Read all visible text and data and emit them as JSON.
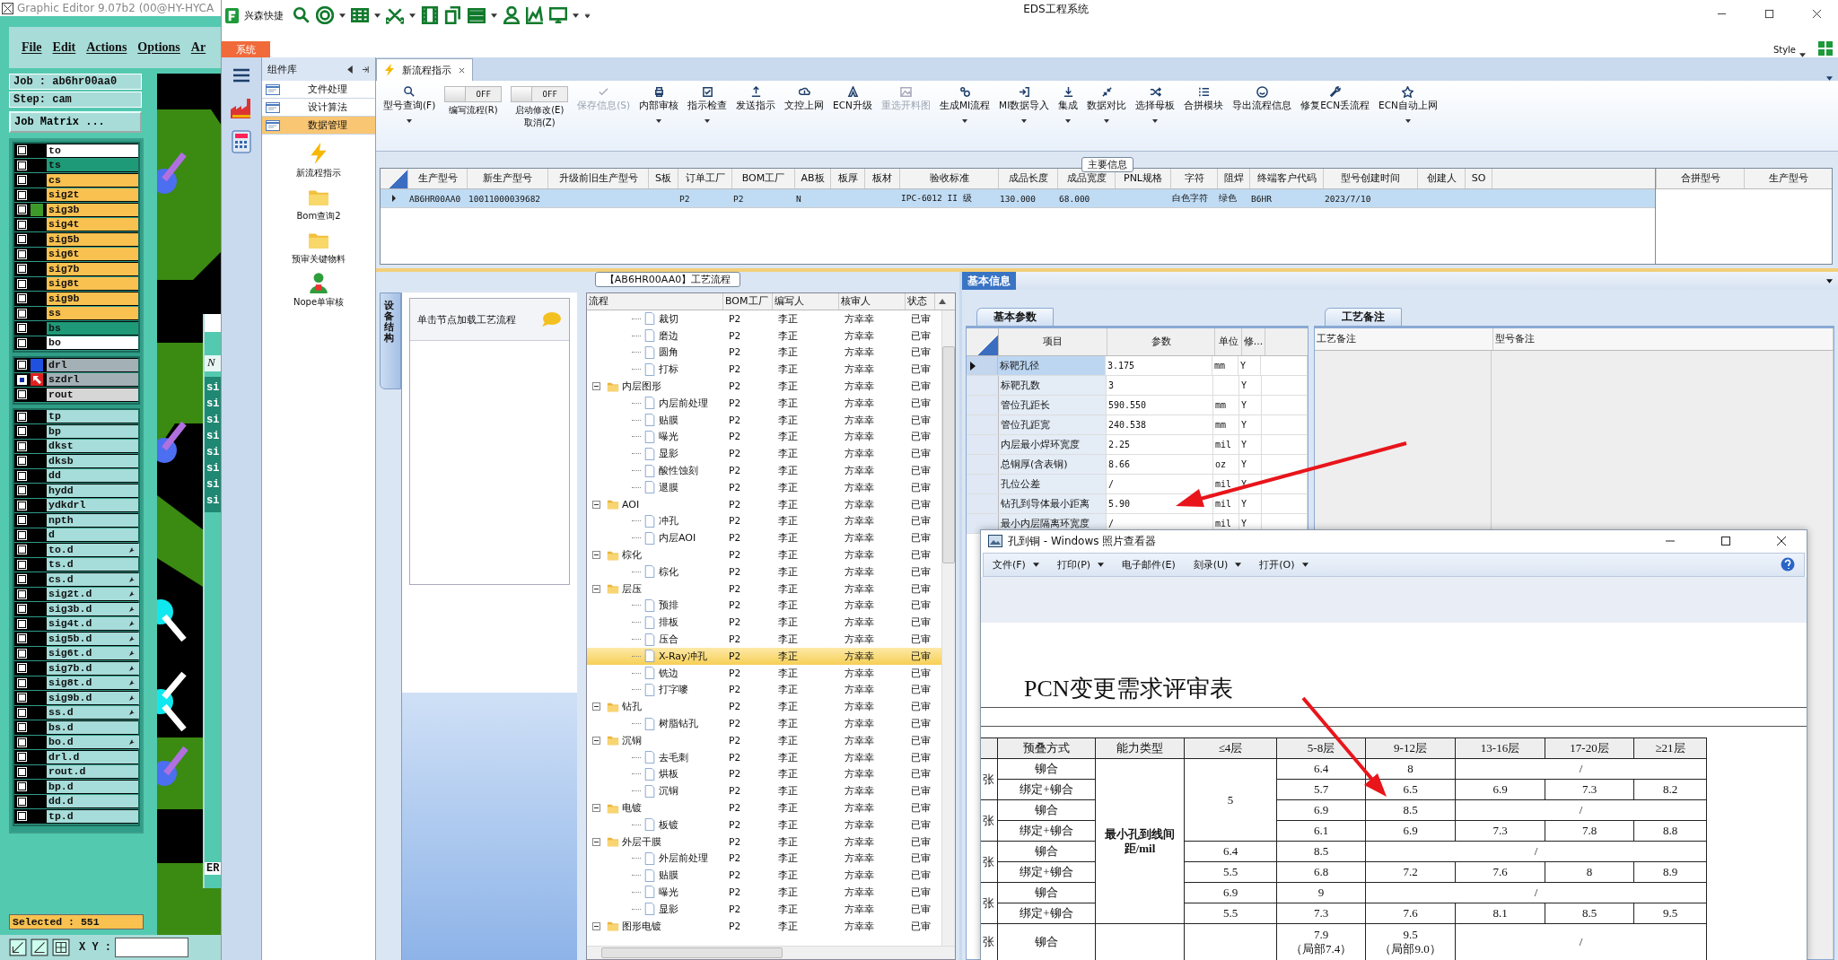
{
  "editor": {
    "title": "Graphic Editor 9.07b2 (00@HY-HYCA",
    "menu": [
      "File",
      "Edit",
      "Actions",
      "Options",
      "Ar"
    ],
    "job": "Job : ab6hr00aa0",
    "step": "Step: cam",
    "matrix_button": "Job Matrix ...",
    "board_layers": [
      {
        "name": "to",
        "color": "#ffffff",
        "checked": false
      },
      {
        "name": "ts",
        "color": "#1f9a78",
        "checked": false
      },
      {
        "name": "cs",
        "color": "#f8c150",
        "checked": false
      },
      {
        "name": "sig2t",
        "color": "#f8c150",
        "checked": false
      },
      {
        "name": "sig3b",
        "color": "#f8c150",
        "swatch": {
          "color": "#3d9a2a"
        },
        "checked": false
      },
      {
        "name": "sig4t",
        "color": "#f8c150",
        "checked": false
      },
      {
        "name": "sig5b",
        "color": "#f8c150",
        "checked": false
      },
      {
        "name": "sig6t",
        "color": "#f8c150",
        "checked": false
      },
      {
        "name": "sig7b",
        "color": "#f8c150",
        "checked": false
      },
      {
        "name": "sig8t",
        "color": "#f8c150",
        "checked": false
      },
      {
        "name": "sig9b",
        "color": "#f8c150",
        "checked": false
      },
      {
        "name": "ss",
        "color": "#f8c150",
        "checked": false
      },
      {
        "name": "bs",
        "color": "#1f9a78",
        "checked": false
      },
      {
        "name": "bo",
        "color": "#ffffff",
        "checked": false
      }
    ],
    "drill_layers": [
      {
        "name": "drl",
        "color": "#a3b0b6",
        "swatch": {
          "color": "#2050e0"
        },
        "selected": false
      },
      {
        "name": "szdrl",
        "color": "#a3b0b6",
        "selected": true
      },
      {
        "name": "rout",
        "color": "#d6d6d6",
        "selected": false
      }
    ],
    "misc_layers": [
      {
        "name": "tp",
        "color": "#a6dcd9",
        "flag": false,
        "checked": false
      },
      {
        "name": "bp",
        "color": "#a6dcd9",
        "flag": false,
        "checked": false
      },
      {
        "name": "dkst",
        "color": "#a6dcd9",
        "flag": false,
        "checked": false
      },
      {
        "name": "dksb",
        "color": "#a6dcd9",
        "flag": false,
        "checked": false
      },
      {
        "name": "dd",
        "color": "#a6dcd9",
        "flag": false,
        "checked": false
      },
      {
        "name": "hydd",
        "color": "#a6dcd9",
        "flag": false,
        "checked": false
      },
      {
        "name": "ydkdrl",
        "color": "#a6dcd9",
        "flag": false,
        "checked": false
      },
      {
        "name": "npth",
        "color": "#a6dcd9",
        "flag": false,
        "checked": false
      },
      {
        "name": "d",
        "color": "#a6dcd9",
        "flag": false,
        "checked": false
      },
      {
        "name": "to.d",
        "color": "#a6dcd9",
        "flag": true,
        "checked": false
      },
      {
        "name": "ts.d",
        "color": "#a6dcd9",
        "flag": false,
        "checked": false
      },
      {
        "name": "cs.d",
        "color": "#a6dcd9",
        "flag": true,
        "checked": false
      },
      {
        "name": "sig2t.d",
        "color": "#a6dcd9",
        "flag": true,
        "checked": false
      },
      {
        "name": "sig3b.d",
        "color": "#a6dcd9",
        "flag": true,
        "checked": false
      },
      {
        "name": "sig4t.d",
        "color": "#a6dcd9",
        "flag": true,
        "checked": false
      },
      {
        "name": "sig5b.d",
        "color": "#a6dcd9",
        "flag": true,
        "checked": false
      },
      {
        "name": "sig6t.d",
        "color": "#a6dcd9",
        "flag": true,
        "checked": false
      },
      {
        "name": "sig7b.d",
        "color": "#a6dcd9",
        "flag": true,
        "checked": false
      },
      {
        "name": "sig8t.d",
        "color": "#a6dcd9",
        "flag": true,
        "checked": false
      },
      {
        "name": "sig9b.d",
        "color": "#a6dcd9",
        "flag": true,
        "checked": false
      },
      {
        "name": "ss.d",
        "color": "#a6dcd9",
        "flag": true,
        "checked": false
      },
      {
        "name": "bs.d",
        "color": "#a6dcd9",
        "flag": false,
        "checked": false
      },
      {
        "name": "bo.d",
        "color": "#a6dcd9",
        "flag": true,
        "checked": false
      },
      {
        "name": "drl.d",
        "color": "#a6dcd9",
        "flag": false,
        "checked": false
      },
      {
        "name": "rout.d",
        "color": "#a6dcd9",
        "flag": false,
        "checked": false
      },
      {
        "name": "bp.d",
        "color": "#a6dcd9",
        "flag": false,
        "checked": false
      },
      {
        "name": "dd.d",
        "color": "#a6dcd9",
        "flag": false,
        "checked": false
      },
      {
        "name": "tp.d",
        "color": "#a6dcd9",
        "flag": false,
        "checked": false
      }
    ],
    "dialog": {
      "field": "N",
      "items": [
        "si",
        "si",
        "si",
        "si",
        "si",
        "si",
        "si",
        "si"
      ],
      "label": "ER"
    },
    "selected": "Selected : 551",
    "xy_label": "X Y :"
  },
  "app": {
    "name": "兴森快捷",
    "title": "EDS工程系统",
    "system_tab": "系统",
    "style_label": "Style"
  },
  "components": {
    "title": "组件库",
    "categories": [
      {
        "label": "文件处理",
        "selected": false
      },
      {
        "label": "设计算法",
        "selected": false
      },
      {
        "label": "数据管理",
        "selected": true
      }
    ],
    "tools": [
      {
        "label": "新流程指示"
      },
      {
        "label": "Bom查询2"
      },
      {
        "label": "预审关键物料"
      },
      {
        "label": "Nope单审核"
      }
    ]
  },
  "tab": {
    "label": "新流程指示",
    "selected": true
  },
  "toolbar": [
    {
      "kind": "button",
      "label": "型号查询(F)",
      "dropdown": true,
      "disabled": false
    },
    {
      "kind": "toggle",
      "text": "OFF",
      "on": false,
      "label": "编写流程(R)"
    },
    {
      "kind": "toggle",
      "text": "OFF",
      "on": false,
      "label": "启动修改(E)",
      "label2": "取消(Z)"
    },
    {
      "kind": "button",
      "label": "保存信息(S)",
      "dropdown": false,
      "disabled": true
    },
    {
      "kind": "button",
      "label": "内部审核",
      "dropdown": true,
      "disabled": false
    },
    {
      "kind": "button",
      "label": "指示检查",
      "dropdown": true,
      "disabled": false
    },
    {
      "kind": "button",
      "label": "发送指示",
      "dropdown": false,
      "disabled": false
    },
    {
      "kind": "button",
      "label": "文控上网",
      "dropdown": false,
      "disabled": false
    },
    {
      "kind": "button",
      "label": "ECN升级",
      "dropdown": false,
      "disabled": false
    },
    {
      "kind": "button",
      "label": "重选开料图",
      "dropdown": false,
      "disabled": true
    },
    {
      "kind": "button",
      "label": "生成MI流程",
      "dropdown": true,
      "disabled": false
    },
    {
      "kind": "button",
      "label": "MI数据导入",
      "dropdown": true,
      "disabled": false
    },
    {
      "kind": "button",
      "label": "集成",
      "dropdown": true,
      "disabled": false
    },
    {
      "kind": "button",
      "label": "数据对比",
      "dropdown": true,
      "disabled": false
    },
    {
      "kind": "button",
      "label": "选择母板",
      "dropdown": true,
      "disabled": false
    },
    {
      "kind": "button",
      "label": "合拼模块",
      "dropdown": false,
      "disabled": false
    },
    {
      "kind": "button",
      "label": "导出流程信息",
      "dropdown": false,
      "disabled": false
    },
    {
      "kind": "button",
      "label": "修复ECN丢流程",
      "dropdown": false,
      "disabled": false
    },
    {
      "kind": "button",
      "label": "ECN自动上网",
      "dropdown": true,
      "disabled": false
    }
  ],
  "main_info": {
    "legend": "主要信息",
    "columns": [
      "生产型号",
      "新生产型号",
      "升级前旧生产型号",
      "S板",
      "订单工厂",
      "BOM工厂",
      "AB板",
      "板厚",
      "板材",
      "验收标准",
      "成品长度",
      "成品宽度",
      "PNL规格",
      "字符",
      "阻焊",
      "终端客户代码",
      "型号创建时间",
      "创建人",
      "SO"
    ],
    "rows": [
      {
        "selected": true,
        "cells": [
          {
            "text": "AB6HR00AA0"
          },
          {
            "text": "10011000039682"
          },
          {},
          {},
          {
            "text": "P2"
          },
          {
            "text": "P2"
          },
          {
            "text": "N"
          },
          {},
          {},
          {
            "text": "IPC-6012 II 级"
          },
          {
            "text": "130.000"
          },
          {
            "text": "68.000"
          },
          {},
          {
            "text": "白色字符"
          },
          {
            "text": "绿色"
          },
          {
            "text": "B6HR"
          },
          {
            "text": "2023/7/10"
          },
          {},
          {}
        ]
      }
    ],
    "side_columns": [
      "合拼型号",
      "生产型号"
    ]
  },
  "flow": {
    "title": "【AB6HR00AA0】工艺流程",
    "side_tab": "设备结构",
    "hint": "单击节点加载工艺流程",
    "columns": [
      "流程",
      "BOM工厂",
      "编写人",
      "核审人",
      "状态"
    ],
    "tree": [
      {
        "kind": "leaf",
        "label": "裁切",
        "bom": "P2",
        "writer": "李正",
        "reviewer": "方幸幸",
        "status": "已审",
        "selected": false
      },
      {
        "kind": "leaf",
        "label": "磨边",
        "bom": "P2",
        "writer": "李正",
        "reviewer": "方幸幸",
        "status": "已审",
        "selected": false
      },
      {
        "kind": "leaf",
        "label": "圆角",
        "bom": "P2",
        "writer": "李正",
        "reviewer": "方幸幸",
        "status": "已审",
        "selected": false
      },
      {
        "kind": "leaf",
        "label": "打标",
        "bom": "P2",
        "writer": "李正",
        "reviewer": "方幸幸",
        "status": "已审",
        "selected": false
      },
      {
        "kind": "folder",
        "label": "内层图形",
        "bom": "P2",
        "writer": "李正",
        "reviewer": "方幸幸",
        "status": "已审",
        "selected": false,
        "expanded": true,
        "children": [
          {
            "kind": "leaf",
            "label": "内层前处理",
            "bom": "P2",
            "writer": "李正",
            "reviewer": "方幸幸",
            "status": "已审",
            "selected": false
          },
          {
            "kind": "leaf",
            "label": "贴膜",
            "bom": "P2",
            "writer": "李正",
            "reviewer": "方幸幸",
            "status": "已审",
            "selected": false
          },
          {
            "kind": "leaf",
            "label": "曝光",
            "bom": "P2",
            "writer": "李正",
            "reviewer": "方幸幸",
            "status": "已审",
            "selected": false
          },
          {
            "kind": "leaf",
            "label": "显影",
            "bom": "P2",
            "writer": "李正",
            "reviewer": "方幸幸",
            "status": "已审",
            "selected": false
          },
          {
            "kind": "leaf",
            "label": "酸性蚀刻",
            "bom": "P2",
            "writer": "李正",
            "reviewer": "方幸幸",
            "status": "已审",
            "selected": false
          },
          {
            "kind": "leaf",
            "label": "退膜",
            "bom": "P2",
            "writer": "李正",
            "reviewer": "方幸幸",
            "status": "已审",
            "selected": false
          }
        ]
      },
      {
        "kind": "folder",
        "label": "AOI",
        "bom": "P2",
        "writer": "李正",
        "reviewer": "方幸幸",
        "status": "已审",
        "selected": false,
        "expanded": true,
        "children": [
          {
            "kind": "leaf",
            "label": "冲孔",
            "bom": "P2",
            "writer": "李正",
            "reviewer": "方幸幸",
            "status": "已审",
            "selected": false
          },
          {
            "kind": "leaf",
            "label": "内层AOI",
            "bom": "P2",
            "writer": "李正",
            "reviewer": "方幸幸",
            "status": "已审",
            "selected": false
          }
        ]
      },
      {
        "kind": "folder",
        "label": "棕化",
        "bom": "P2",
        "writer": "李正",
        "reviewer": "方幸幸",
        "status": "已审",
        "selected": false,
        "expanded": true,
        "children": [
          {
            "kind": "leaf",
            "label": "棕化",
            "bom": "P2",
            "writer": "李正",
            "reviewer": "方幸幸",
            "status": "已审",
            "selected": false
          }
        ]
      },
      {
        "kind": "folder",
        "label": "层压",
        "bom": "P2",
        "writer": "李正",
        "reviewer": "方幸幸",
        "status": "已审",
        "selected": false,
        "expanded": true,
        "children": [
          {
            "kind": "leaf",
            "label": "预排",
            "bom": "P2",
            "writer": "李正",
            "reviewer": "方幸幸",
            "status": "已审",
            "selected": false
          },
          {
            "kind": "leaf",
            "label": "排板",
            "bom": "P2",
            "writer": "李正",
            "reviewer": "方幸幸",
            "status": "已审",
            "selected": false
          },
          {
            "kind": "leaf",
            "label": "压合",
            "bom": "P2",
            "writer": "李正",
            "reviewer": "方幸幸",
            "status": "已审",
            "selected": false
          },
          {
            "kind": "leaf",
            "label": "X-Ray冲孔",
            "bom": "P2",
            "writer": "李正",
            "reviewer": "方幸幸",
            "status": "已审",
            "selected": true
          },
          {
            "kind": "leaf",
            "label": "铣边",
            "bom": "P2",
            "writer": "李正",
            "reviewer": "方幸幸",
            "status": "已审",
            "selected": false
          },
          {
            "kind": "leaf",
            "label": "打字嘜",
            "bom": "P2",
            "writer": "李正",
            "reviewer": "方幸幸",
            "status": "已审",
            "selected": false
          }
        ]
      },
      {
        "kind": "folder",
        "label": "钻孔",
        "bom": "P2",
        "writer": "李正",
        "reviewer": "方幸幸",
        "status": "已审",
        "selected": false,
        "expanded": true,
        "children": [
          {
            "kind": "leaf",
            "label": "树脂钻孔",
            "bom": "P2",
            "writer": "李正",
            "reviewer": "方幸幸",
            "status": "已审",
            "selected": false
          }
        ]
      },
      {
        "kind": "folder",
        "label": "沉铜",
        "bom": "P2",
        "writer": "李正",
        "reviewer": "方幸幸",
        "status": "已审",
        "selected": false,
        "expanded": true,
        "children": [
          {
            "kind": "leaf",
            "label": "去毛刺",
            "bom": "P2",
            "writer": "李正",
            "reviewer": "方幸幸",
            "status": "已审",
            "selected": false
          },
          {
            "kind": "leaf",
            "label": "烘板",
            "bom": "P2",
            "writer": "李正",
            "reviewer": "方幸幸",
            "status": "已审",
            "selected": false
          },
          {
            "kind": "leaf",
            "label": "沉铜",
            "bom": "P2",
            "writer": "李正",
            "reviewer": "方幸幸",
            "status": "已审",
            "selected": false
          }
        ]
      },
      {
        "kind": "folder",
        "label": "电镀",
        "bom": "P2",
        "writer": "李正",
        "reviewer": "方幸幸",
        "status": "已审",
        "selected": false,
        "expanded": true,
        "children": [
          {
            "kind": "leaf",
            "label": "板镀",
            "bom": "P2",
            "writer": "李正",
            "reviewer": "方幸幸",
            "status": "已审",
            "selected": false
          }
        ]
      },
      {
        "kind": "folder",
        "label": "外层干膜",
        "bom": "P2",
        "writer": "李正",
        "reviewer": "方幸幸",
        "status": "已审",
        "selected": false,
        "expanded": true,
        "children": [
          {
            "kind": "leaf",
            "label": "外层前处理",
            "bom": "P2",
            "writer": "李正",
            "reviewer": "方幸幸",
            "status": "已审",
            "selected": false
          },
          {
            "kind": "leaf",
            "label": "贴膜",
            "bom": "P2",
            "writer": "李正",
            "reviewer": "方幸幸",
            "status": "已审",
            "selected": false
          },
          {
            "kind": "leaf",
            "label": "曝光",
            "bom": "P2",
            "writer": "李正",
            "reviewer": "方幸幸",
            "status": "已审",
            "selected": false
          },
          {
            "kind": "leaf",
            "label": "显影",
            "bom": "P2",
            "writer": "李正",
            "reviewer": "方幸幸",
            "status": "已审",
            "selected": false
          }
        ]
      },
      {
        "kind": "folder",
        "label": "图形电镀",
        "bom": "P2",
        "writer": "李正",
        "reviewer": "方幸幸",
        "status": "已审",
        "selected": false,
        "expanded": true
      }
    ]
  },
  "basic_info": {
    "tab": "基本信息",
    "params_tab": "基本参数",
    "notes_tab": "工艺备注",
    "columns": [
      "项目",
      "参数",
      "单位",
      "修..."
    ],
    "params": [
      {
        "item": "标靶孔径",
        "value": "3.175",
        "unit": "mm",
        "mod": "Y",
        "selected": true
      },
      {
        "item": "标靶孔数",
        "value": "3",
        "mod": "Y",
        "selected": false
      },
      {
        "item": "管位孔距长",
        "value": "590.550",
        "unit": "mm",
        "mod": "Y",
        "selected": false
      },
      {
        "item": "管位孔距宽",
        "value": "240.538",
        "unit": "mm",
        "mod": "Y",
        "selected": false
      },
      {
        "item": "内层最小焊环宽度",
        "value": "2.25",
        "unit": "mil",
        "mod": "Y",
        "selected": false
      },
      {
        "item": "总铜厚(含表铜)",
        "value": "8.66",
        "unit": "oz",
        "mod": "Y",
        "selected": false
      },
      {
        "item": "孔位公差",
        "value": "/",
        "unit": "mil",
        "mod": "Y",
        "selected": false
      },
      {
        "item": "钻孔到导体最小距离",
        "value": "5.90",
        "unit": "mil",
        "mod": "Y",
        "selected": false
      },
      {
        "item": "最小内层隔离环宽度",
        "value": "/",
        "unit": "mil",
        "mod": "Y",
        "selected": false
      }
    ],
    "notes_columns": [
      "工艺备注",
      "型号备注"
    ]
  },
  "viewer": {
    "title": "孔到铜 - Windows 照片查看器",
    "menu": [
      {
        "label": "文件(F)",
        "dropdown": true
      },
      {
        "label": "打印(P)",
        "dropdown": true
      },
      {
        "label": "电子邮件(E)",
        "dropdown": false
      },
      {
        "label": "刻录(U)",
        "dropdown": true
      },
      {
        "label": "打开(O)",
        "dropdown": true
      }
    ],
    "doc_title": "PCN变更需求评审表",
    "header": [
      "预叠方式",
      "能力类型",
      "≤4层",
      "5-8层",
      "9-12层",
      "13-16层",
      "17-20层",
      "≥21层"
    ],
    "rows": [
      [
        {
          "text": "张",
          "rowspan": 2
        },
        {
          "text": "铆合"
        },
        {
          "text": "最小孔到线间距/mil",
          "rowspan": 8,
          "kind": "caption"
        },
        {
          "text": "5",
          "rowspan": 4
        },
        {
          "text": "6.4"
        },
        {
          "text": "8"
        },
        {
          "text": "/",
          "colspan": 3
        }
      ],
      [
        {
          "text": "绑定+铆合"
        },
        {
          "text": "5.7"
        },
        {
          "text": "6.5"
        },
        {
          "text": "6.9"
        },
        {
          "text": "7.3"
        },
        {
          "text": "8.2"
        }
      ],
      [
        {
          "text": "张",
          "rowspan": 2
        },
        {
          "text": "铆合"
        },
        {
          "text": "6.9"
        },
        {
          "text": "8.5"
        },
        {
          "text": "/",
          "colspan": 3
        }
      ],
      [
        {
          "text": "绑定+铆合"
        },
        {
          "text": "6.1"
        },
        {
          "text": "6.9"
        },
        {
          "text": "7.3"
        },
        {
          "text": "7.8"
        },
        {
          "text": "8.8"
        }
      ],
      [
        {
          "text": "张",
          "rowspan": 2
        },
        {
          "text": "铆合"
        },
        {
          "text": "6.4"
        },
        {
          "text": "8.5"
        },
        {
          "text": "/",
          "colspan": 4
        }
      ],
      [
        {
          "text": "绑定+铆合"
        },
        {
          "text": "5.5"
        },
        {
          "text": "6.8"
        },
        {
          "text": "7.2"
        },
        {
          "text": "7.6"
        },
        {
          "text": "8"
        },
        {
          "text": "8.9"
        }
      ],
      [
        {
          "text": "张",
          "rowspan": 2
        },
        {
          "text": "铆合"
        },
        {
          "text": "6.9"
        },
        {
          "text": "9"
        },
        {
          "text": "/",
          "colspan": 4
        }
      ],
      [
        {
          "text": "绑定+铆合"
        },
        {
          "text": "5.5"
        },
        {
          "text": "7.3"
        },
        {
          "text": "7.6"
        },
        {
          "text": "8.1"
        },
        {
          "text": "8.5"
        },
        {
          "text": "9.5"
        }
      ],
      [
        {
          "text": "张"
        },
        {
          "text": "铆合"
        },
        {},
        {},
        {
          "text": "7.9\n（局部7.4）"
        },
        {
          "text": "9.5\n（局部9.0）"
        },
        {
          "text": "/",
          "colspan": 3
        }
      ]
    ]
  }
}
